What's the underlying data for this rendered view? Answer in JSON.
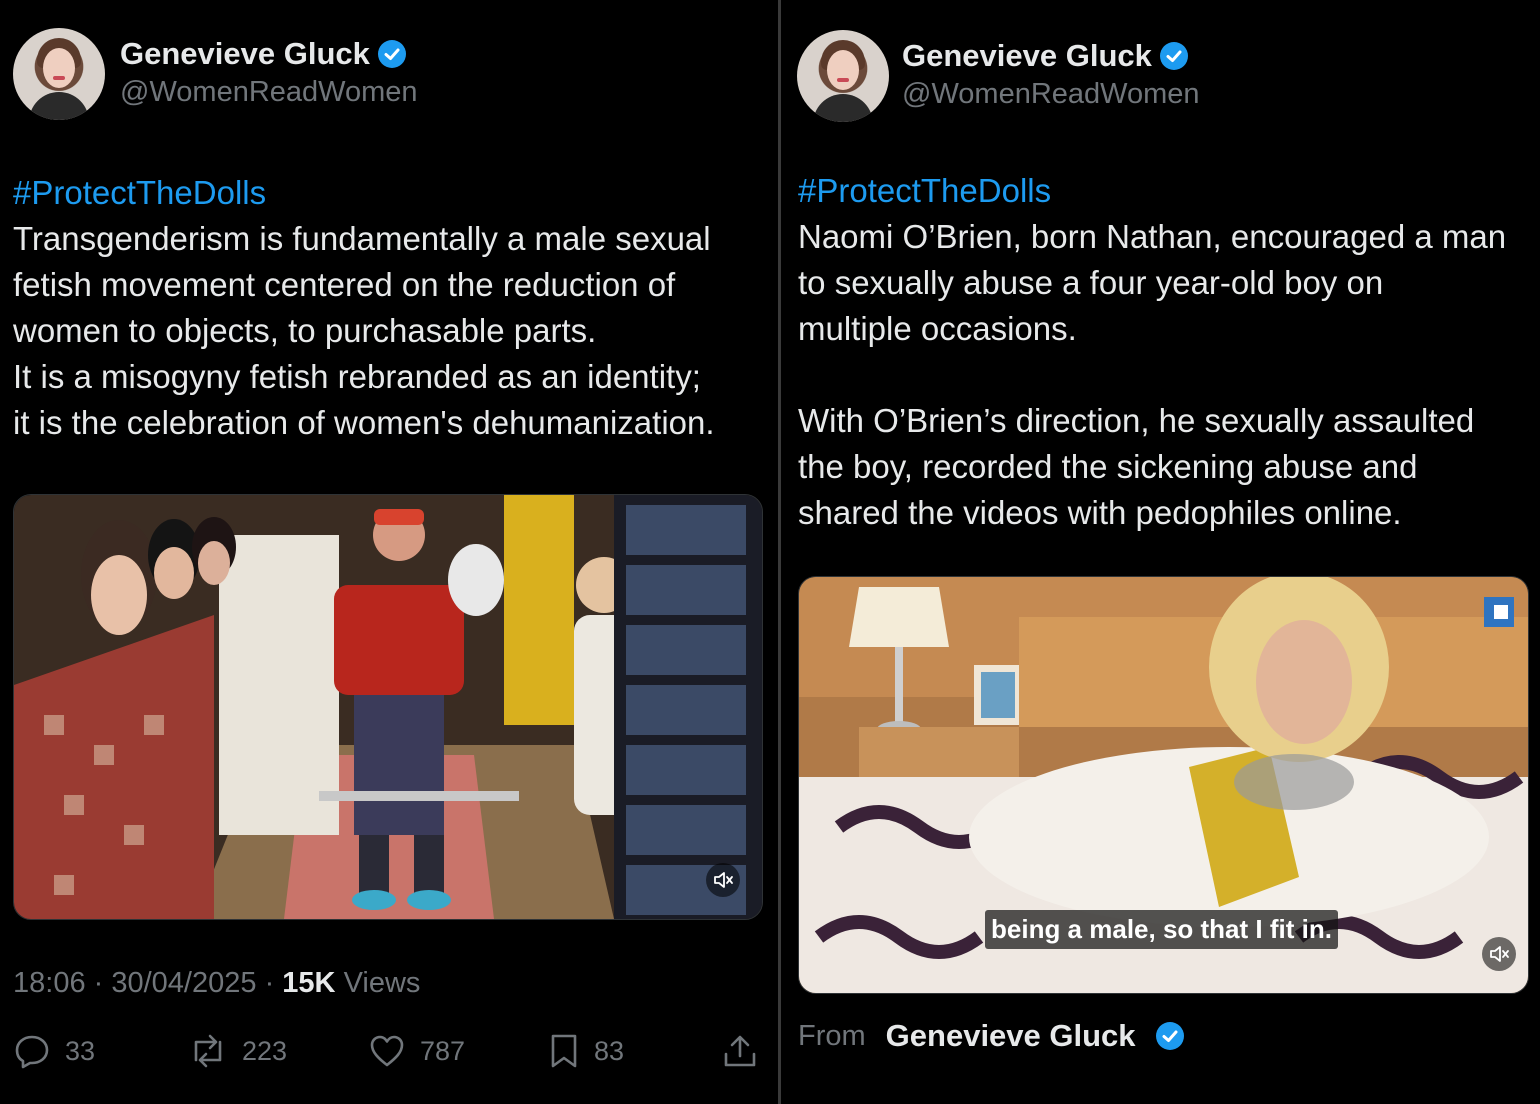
{
  "left_tweet": {
    "author_name": "Genevieve Gluck",
    "handle": "@WomenReadWomen",
    "hashtag": "#ProtectTheDolls",
    "body": "Transgenderism is fundamentally a male sexual\nfetish movement centered on the reduction of\nwomen to objects, to purchasable parts.\nIt is a misogyny fetish rebranded as an identity;\nit is the celebration of women's dehumanization.",
    "time": "18:06",
    "date": "30/04/2025",
    "views_count": "15K",
    "views_label": "Views",
    "replies": "33",
    "reposts": "223",
    "likes": "787",
    "bookmarks": "83"
  },
  "right_tweet": {
    "author_name": "Genevieve Gluck",
    "handle": "@WomenReadWomen",
    "hashtag": "#ProtectTheDolls",
    "body": "Naomi O’Brien, born Nathan, encouraged a man\nto sexually abuse a four year-old boy on\nmultiple occasions.\n\nWith O’Brien’s direction, he sexually assaulted\nthe boy, recorded the sickening abuse and\nshared the videos with pedophiles online.",
    "video_caption": "being a male, so that I fit in.",
    "from_label": "From",
    "from_name": "Genevieve Gluck"
  },
  "colors": {
    "background": "#000000",
    "text": "#e7e9ea",
    "secondary_text": "#71767b",
    "accent": "#1d9bf0"
  }
}
